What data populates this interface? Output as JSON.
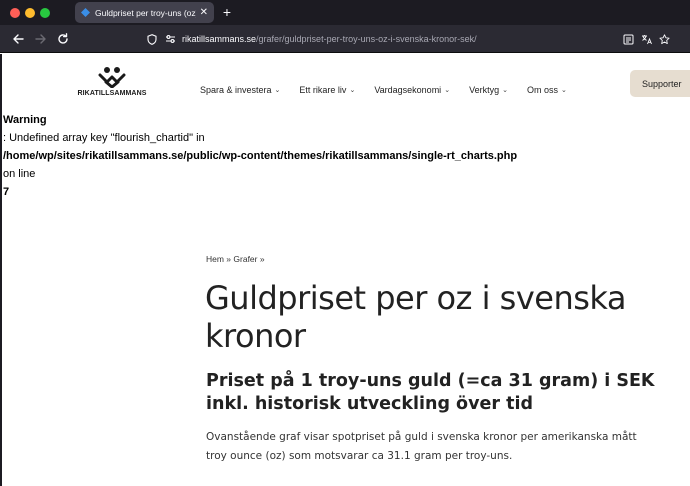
{
  "browser": {
    "tab": {
      "title": "Guldpriset per troy-uns (oz) i svenska kronor (SEK)",
      "close": "✕"
    },
    "new_tab": "+",
    "url": {
      "host": "rikatillsammans.se",
      "path": "/grafer/guldpriset-per-troy-uns-oz-i-svenska-kronor-sek/"
    }
  },
  "site": {
    "logo_text": "RIKATILLSAMMANS",
    "nav": [
      {
        "label": "Spara & investera"
      },
      {
        "label": "Ett rikare liv"
      },
      {
        "label": "Vardagsekonomi"
      },
      {
        "label": "Verktyg"
      },
      {
        "label": "Om oss"
      }
    ],
    "support_label": "Supporter"
  },
  "warning": {
    "title": "Warning",
    "message": ": Undefined array key \"flourish_chartid\" in",
    "file": "/home/wp/sites/rikatillsammans.se/public/wp-content/themes/rikatillsammans/single-rt_charts.php",
    "on_line": "on line",
    "line_number": "7"
  },
  "article": {
    "breadcrumb": "Hem » Grafer »",
    "title": "Guldpriset per oz i svenska kronor",
    "subtitle": "Priset på 1 troy-uns guld (=ca 31 gram) i SEK inkl. historisk utveckling över tid",
    "intro": "Ovanstående graf visar spotpriset på guld i svenska kronor per amerikanska mått troy ounce (oz) som motsvarar ca 31.1 gram per troy-uns."
  },
  "colors": {
    "chrome_dark": "#1c1b22",
    "toolbar": "#2b2a33",
    "support_button": "#e6ddd0"
  }
}
